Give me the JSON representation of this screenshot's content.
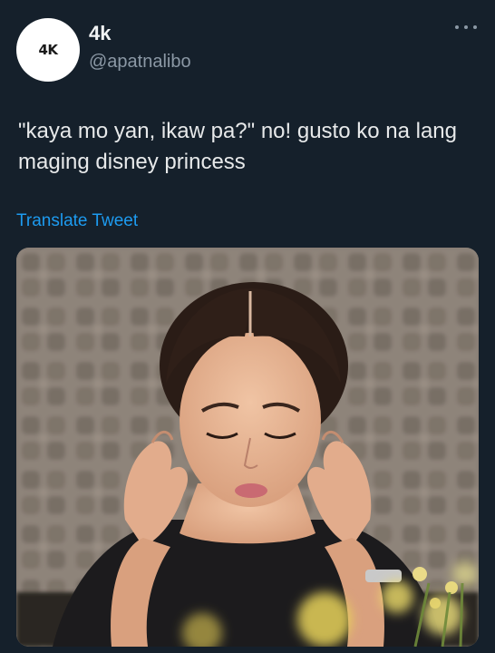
{
  "author": {
    "avatar_text": "4K",
    "name": "4k",
    "handle": "@apatnalibo"
  },
  "tweet": {
    "text": "\"kaya mo yan, ikaw pa?\" no! gusto ko na lang maging disney princess",
    "translate_label": "Translate Tweet"
  },
  "icons": {
    "more": "more-horizontal-icon"
  },
  "colors": {
    "background": "#15202b",
    "link": "#1d9bf0",
    "secondary_text": "#8b98a5"
  }
}
